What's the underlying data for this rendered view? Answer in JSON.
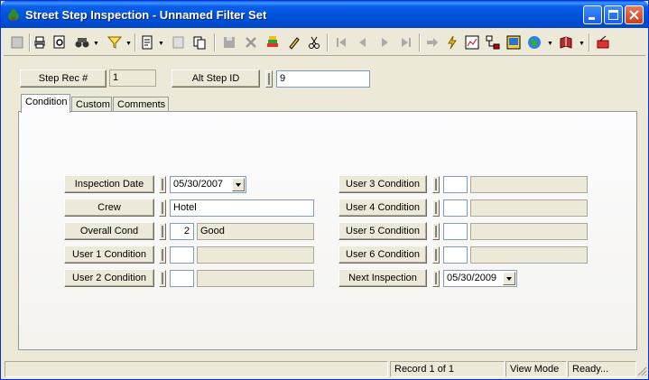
{
  "window": {
    "title": "Street Step Inspection - Unnamed Filter Set"
  },
  "header": {
    "step_rec_label": "Step Rec #",
    "step_rec_value": "1",
    "alt_step_label": "Alt Step ID",
    "alt_step_value": "9"
  },
  "tabs": [
    {
      "label": "Condition"
    },
    {
      "label": "Custom"
    },
    {
      "label": "Comments"
    }
  ],
  "left_fields": {
    "inspection_date": {
      "label": "Inspection Date",
      "value": "05/30/2007"
    },
    "crew": {
      "label": "Crew",
      "value": "Hotel"
    },
    "overall_cond": {
      "label": "Overall Cond",
      "code": "2",
      "desc": "Good"
    },
    "user1": {
      "label": "User 1 Condition",
      "code": "",
      "desc": ""
    },
    "user2": {
      "label": "User 2 Condition",
      "code": "",
      "desc": ""
    }
  },
  "right_fields": {
    "user3": {
      "label": "User 3 Condition",
      "code": "",
      "desc": ""
    },
    "user4": {
      "label": "User 4 Condition",
      "code": "",
      "desc": ""
    },
    "user5": {
      "label": "User 5 Condition",
      "code": "",
      "desc": ""
    },
    "user6": {
      "label": "User 6 Condition",
      "code": "",
      "desc": ""
    },
    "next_inspection": {
      "label": "Next Inspection",
      "value": "05/30/2009"
    }
  },
  "statusbar": {
    "record": "Record 1 of 1",
    "mode": "View Mode",
    "state": "Ready..."
  },
  "colors": {
    "titlebar": "#0050d8",
    "face": "#ece9d8",
    "close": "#c9401d"
  }
}
